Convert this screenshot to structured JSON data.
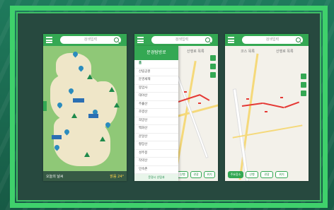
{
  "search": {
    "placeholder": "검색입력"
  },
  "phone1": {
    "footer_text": "오늘의 날씨",
    "weather_text": "맑음 24°"
  },
  "phone2": {
    "drawer_title": "문경탐방로",
    "top_chip": "산행로 목록",
    "menu_items": [
      "홈",
      "산림공원",
      "문경새재",
      "봉암사",
      "대야산",
      "주흘산",
      "조령산",
      "희양산",
      "백화산",
      "운달산",
      "황장산",
      "성주봉",
      "작약산",
      "민속촌",
      "천주봉"
    ],
    "footer": "문경시 산림과",
    "bottom_buttons": [
      "산행",
      "관광",
      "위치"
    ]
  },
  "phone3": {
    "top_left": "코스 목록",
    "top_right": "산행로 목록",
    "bottom_buttons": [
      "주요장소",
      "산행",
      "관광",
      "위치"
    ]
  },
  "colors": {
    "accent": "#34a853",
    "frame": "#3fd16b",
    "trail": "#e53935"
  }
}
